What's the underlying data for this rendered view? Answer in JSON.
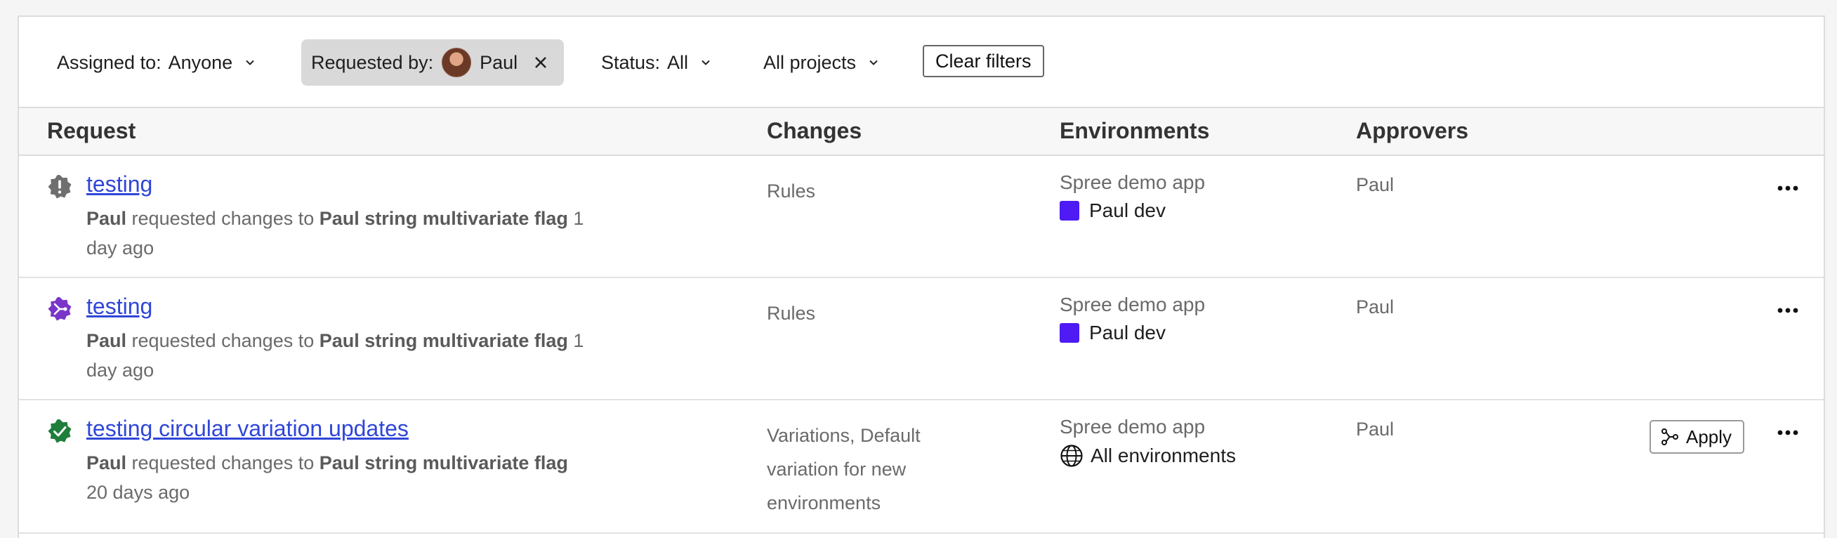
{
  "filters": {
    "assigned": {
      "label": "Assigned to:",
      "value": "Anyone"
    },
    "requested": {
      "label": "Requested by:",
      "value": "Paul"
    },
    "status": {
      "label": "Status:",
      "value": "All"
    },
    "projects": {
      "value": "All projects"
    },
    "clear_label": "Clear filters"
  },
  "table": {
    "headers": {
      "request": "Request",
      "changes": "Changes",
      "environments": "Environments",
      "approvers": "Approvers"
    },
    "rows": [
      {
        "status_icon": "pending-review-icon",
        "title": "testing",
        "requester": "Paul",
        "action_text": "requested changes to",
        "flag": "Paul string multivariate flag",
        "time": "1 day ago",
        "changes": "Rules",
        "project": "Spree demo app",
        "environment": "Paul dev",
        "env_color": "#4e1bf5",
        "approver": "Paul"
      },
      {
        "status_icon": "merge-pending-icon",
        "title": "testing",
        "requester": "Paul",
        "action_text": "requested changes to",
        "flag": "Paul string multivariate flag",
        "time": "1 day ago",
        "changes": "Rules",
        "project": "Spree demo app",
        "environment": "Paul dev",
        "env_color": "#4e1bf5",
        "approver": "Paul"
      },
      {
        "status_icon": "approved-check-icon",
        "title": "testing circular variation updates",
        "requester": "Paul",
        "action_text": "requested changes to",
        "flag": "Paul string multivariate flag",
        "time": "20 days ago",
        "changes": "Variations, Default variation for new environments",
        "project": "Spree demo app",
        "environment": "All environments",
        "approver": "Paul",
        "apply_label": "Apply"
      }
    ]
  },
  "colors": {
    "link": "#2f46d8",
    "pending": "#6f6f6f",
    "merge": "#7a36c8",
    "approved": "#1e7e3a",
    "env": "#4e1bf5"
  }
}
